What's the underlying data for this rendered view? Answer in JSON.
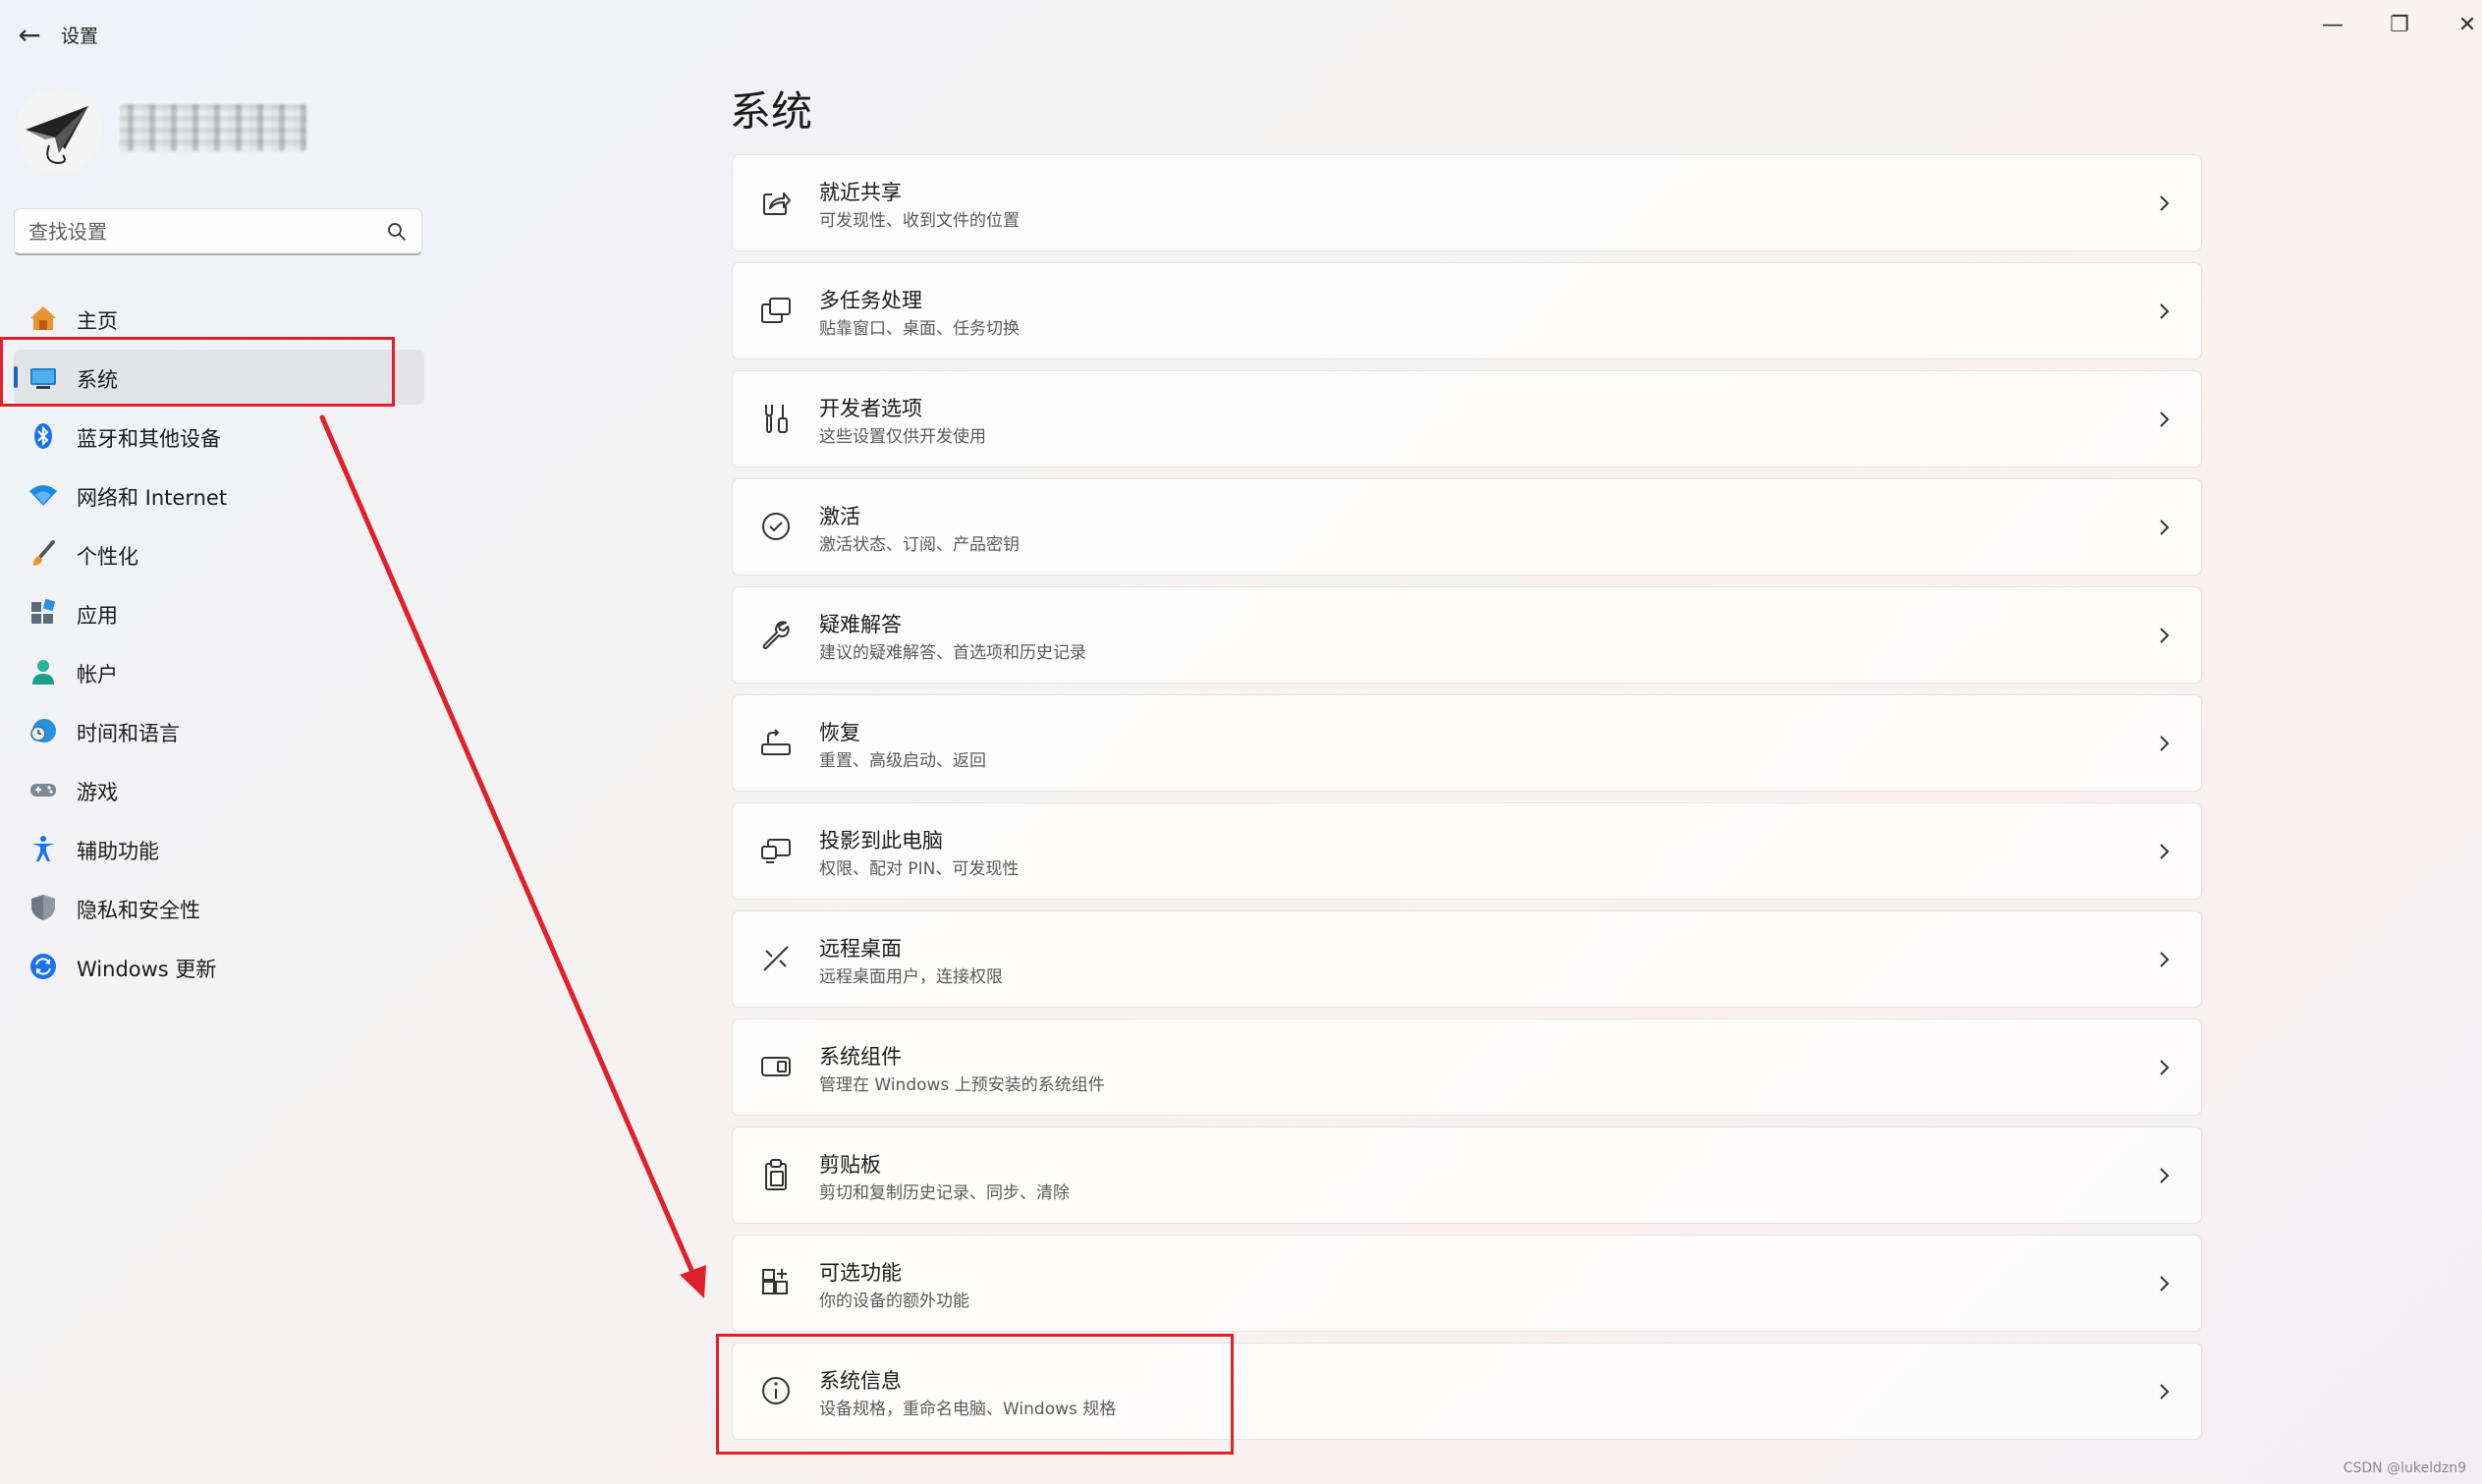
{
  "window": {
    "title": "设置",
    "back_glyph": "←",
    "min_glyph": "—",
    "max_glyph": "❐",
    "close_glyph": "✕"
  },
  "search": {
    "placeholder": "查找设置"
  },
  "sidebar": {
    "items": [
      {
        "label": "主页",
        "icon": "home-icon"
      },
      {
        "label": "系统",
        "icon": "system-icon",
        "active": true
      },
      {
        "label": "蓝牙和其他设备",
        "icon": "bluetooth-icon"
      },
      {
        "label": "网络和 Internet",
        "icon": "wifi-icon"
      },
      {
        "label": "个性化",
        "icon": "brush-icon"
      },
      {
        "label": "应用",
        "icon": "apps-icon"
      },
      {
        "label": "帐户",
        "icon": "account-icon"
      },
      {
        "label": "时间和语言",
        "icon": "clock-globe-icon"
      },
      {
        "label": "游戏",
        "icon": "gamepad-icon"
      },
      {
        "label": "辅助功能",
        "icon": "accessibility-icon"
      },
      {
        "label": "隐私和安全性",
        "icon": "shield-icon"
      },
      {
        "label": "Windows 更新",
        "icon": "update-icon"
      }
    ]
  },
  "main": {
    "title": "系统",
    "items": [
      {
        "title": "就近共享",
        "subtitle": "可发现性、收到文件的位置",
        "icon": "share-icon"
      },
      {
        "title": "多任务处理",
        "subtitle": "贴靠窗口、桌面、任务切换",
        "icon": "multitask-icon"
      },
      {
        "title": "开发者选项",
        "subtitle": "这些设置仅供开发使用",
        "icon": "developer-tools-icon"
      },
      {
        "title": "激活",
        "subtitle": "激活状态、订阅、产品密钥",
        "icon": "check-circle-icon"
      },
      {
        "title": "疑难解答",
        "subtitle": "建议的疑难解答、首选项和历史记录",
        "icon": "wrench-icon"
      },
      {
        "title": "恢复",
        "subtitle": "重置、高级启动、返回",
        "icon": "recovery-icon"
      },
      {
        "title": "投影到此电脑",
        "subtitle": "权限、配对 PIN、可发现性",
        "icon": "project-icon"
      },
      {
        "title": "远程桌面",
        "subtitle": "远程桌面用户，连接权限",
        "icon": "remote-desktop-icon"
      },
      {
        "title": "系统组件",
        "subtitle": "管理在 Windows 上预安装的系统组件",
        "icon": "components-icon"
      },
      {
        "title": "剪贴板",
        "subtitle": "剪切和复制历史记录、同步、清除",
        "icon": "clipboard-icon"
      },
      {
        "title": "可选功能",
        "subtitle": "你的设备的额外功能",
        "icon": "optional-features-icon"
      },
      {
        "title": "系统信息",
        "subtitle": "设备规格，重命名电脑、Windows 规格",
        "icon": "info-icon"
      }
    ]
  },
  "colors": {
    "accent": "#1565c0",
    "annotation": "#e0202a"
  },
  "watermark": "CSDN @lukeldzn9"
}
